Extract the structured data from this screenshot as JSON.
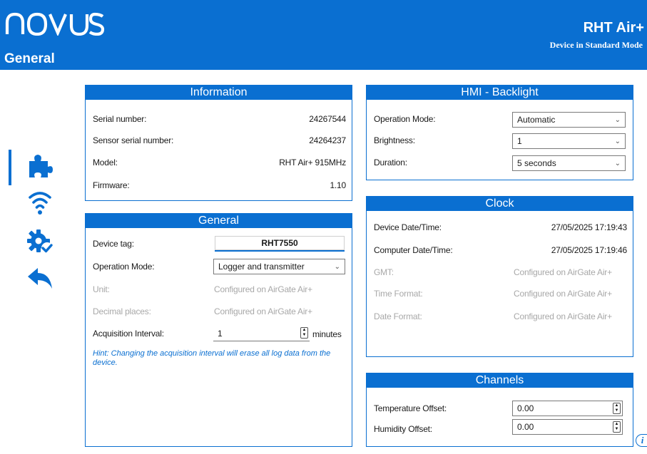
{
  "header": {
    "brand": "NOVUS",
    "page_title": "General",
    "device_name": "RHT Air+",
    "device_mode": "Device in Standard Mode"
  },
  "nav": [
    "puzzle-icon",
    "wifi-icon",
    "gear-check-icon",
    "back-arrow-icon"
  ],
  "colors": {
    "accent": "#0a6fd1",
    "muted": "#a8a8a8"
  },
  "information": {
    "title": "Information",
    "rows": [
      {
        "label": "Serial number:",
        "value": "24267544"
      },
      {
        "label": "Sensor serial number:",
        "value": "24264237"
      },
      {
        "label": "Model:",
        "value": "RHT Air+ 915MHz"
      },
      {
        "label": "Firmware:",
        "value": "1.10"
      }
    ]
  },
  "general": {
    "title": "General",
    "device_tag_label": "Device tag:",
    "device_tag_value": "RHT7550",
    "operation_mode_label": "Operation Mode:",
    "operation_mode_value": "Logger and transmitter",
    "unit_label": "Unit:",
    "unit_value": "Configured on AirGate Air+",
    "decimal_label": "Decimal places:",
    "decimal_value": "Configured on AirGate Air+",
    "acq_label": "Acquisition Interval:",
    "acq_value": "1",
    "acq_unit": "minutes",
    "hint": "Hint: Changing the acquisition interval will erase all log data from the device."
  },
  "hmi": {
    "title": "HMI - Backlight",
    "operation_mode_label": "Operation Mode:",
    "operation_mode_value": "Automatic",
    "brightness_label": "Brightness:",
    "brightness_value": "1",
    "duration_label": "Duration:",
    "duration_value": "5 seconds"
  },
  "clock": {
    "title": "Clock",
    "device_dt_label": "Device Date/Time:",
    "device_dt_value": "27/05/2025 17:19:43",
    "computer_dt_label": "Computer Date/Time:",
    "computer_dt_value": "27/05/2025 17:19:46",
    "gmt_label": "GMT:",
    "gmt_value": "Configured on AirGate Air+",
    "time_format_label": "Time Format:",
    "time_format_value": "Configured on AirGate Air+",
    "date_format_label": "Date Format:",
    "date_format_value": "Configured on AirGate Air+"
  },
  "channels": {
    "title": "Channels",
    "temp_label": "Temperature Offset:",
    "temp_value": "0.00",
    "hum_label": "Humidity Offset:",
    "hum_value": "0.00"
  },
  "info_button": "i"
}
